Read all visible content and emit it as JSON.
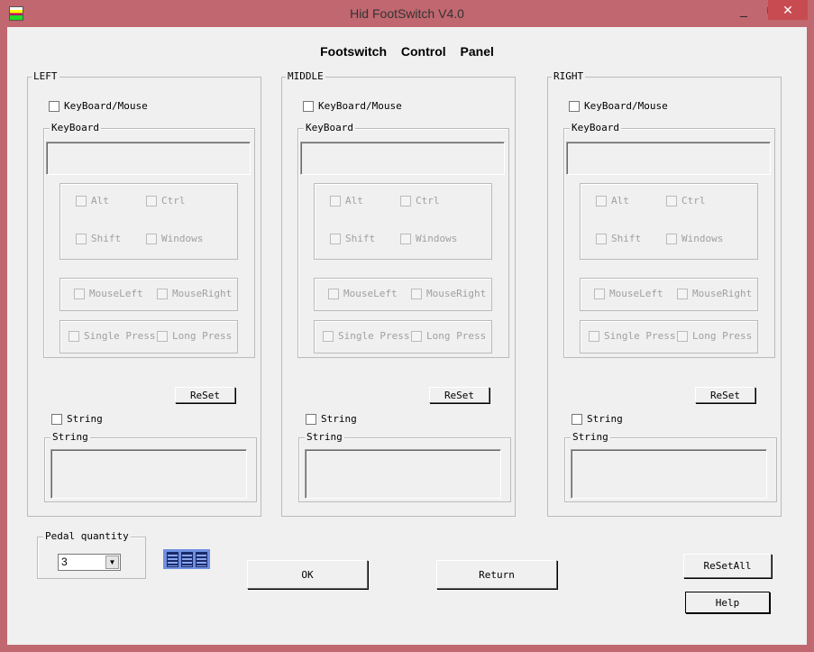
{
  "window": {
    "title": "Hid FootSwitch V4.0",
    "minimize": "_",
    "maximize": "□",
    "close": "✕",
    "close_color": "#c74b50",
    "titlebar_color": "#c0676f"
  },
  "heading": "Footswitch Control Panel",
  "panels": [
    {
      "label": "LEFT",
      "kbm": "KeyBoard/Mouse",
      "keyboard": "KeyBoard",
      "alt": "Alt",
      "ctrl": "Ctrl",
      "shift": "Shift",
      "windows": "Windows",
      "mouseleft": "MouseLeft",
      "mouseright": "MouseRight",
      "single": "Single Press",
      "long": "Long Press",
      "reset": "ReSet",
      "string_cb": "String",
      "string_group": "String"
    },
    {
      "label": "MIDDLE",
      "kbm": "KeyBoard/Mouse",
      "keyboard": "KeyBoard",
      "alt": "Alt",
      "ctrl": "Ctrl",
      "shift": "Shift",
      "windows": "Windows",
      "mouseleft": "MouseLeft",
      "mouseright": "MouseRight",
      "single": "Single Press",
      "long": "Long Press",
      "reset": "ReSet",
      "string_cb": "String",
      "string_group": "String"
    },
    {
      "label": "RIGHT",
      "kbm": "KeyBoard/Mouse",
      "keyboard": "KeyBoard",
      "alt": "Alt",
      "ctrl": "Ctrl",
      "shift": "Shift",
      "windows": "Windows",
      "mouseleft": "MouseLeft",
      "mouseright": "MouseRight",
      "single": "Single Press",
      "long": "Long Press",
      "reset": "ReSet",
      "string_cb": "String",
      "string_group": "String"
    }
  ],
  "pedal": {
    "label": "Pedal quantity",
    "value": "3",
    "icon": "pedal-icon"
  },
  "buttons": {
    "ok": "OK",
    "return": "Return",
    "resetall": "ReSetAll",
    "help": "Help"
  }
}
